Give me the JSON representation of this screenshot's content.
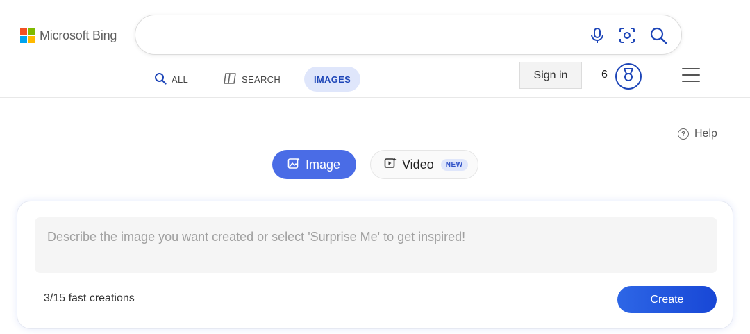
{
  "brand": {
    "name": "Microsoft Bing",
    "logo_colors": [
      "#f25022",
      "#7fba00",
      "#00a4ef",
      "#ffb900"
    ]
  },
  "search": {
    "value": "",
    "placeholder": "",
    "icons": [
      "microphone-icon",
      "visual-search-icon",
      "search-icon"
    ]
  },
  "nav": {
    "tabs": [
      {
        "label": "ALL",
        "icon": "search-icon",
        "active": false
      },
      {
        "label": "SEARCH",
        "icon": "copilot-icon",
        "active": false
      },
      {
        "label": "IMAGES",
        "icon": "",
        "active": true
      }
    ]
  },
  "account": {
    "sign_in_label": "Sign in",
    "reward_points": "6",
    "rewards_icon": "rewards-medal-icon",
    "menu_icon": "hamburger-menu-icon"
  },
  "help": {
    "label": "Help",
    "icon": "help-circle-icon"
  },
  "modes": {
    "image_label": "Image",
    "video_label": "Video",
    "video_badge": "NEW",
    "selected": "Image"
  },
  "creator": {
    "prompt_value": "",
    "prompt_placeholder": "Describe the image you want created or select 'Surprise Me' to get inspired!",
    "fast_creations": "3/15 fast creations",
    "create_label": "Create"
  },
  "colors": {
    "accent": "#4a6ce6",
    "brand_blue": "#1e46b8",
    "create_button": "#2d66e6"
  }
}
